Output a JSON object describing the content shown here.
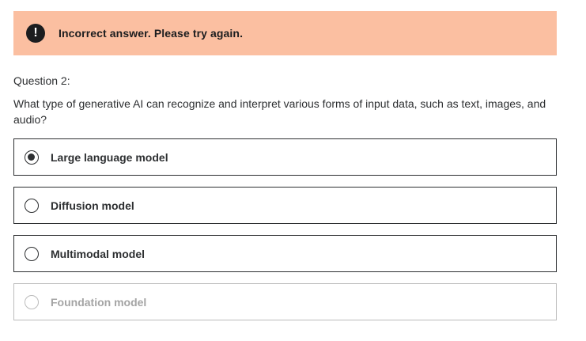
{
  "alert": {
    "icon": "!",
    "icon_name": "exclamation-icon",
    "message": "Incorrect answer. Please try again.",
    "background_color": "#fbbfa1"
  },
  "question": {
    "label": "Question 2:",
    "text": "What type of generative AI can recognize and interpret various forms of input data, such as text, images, and audio?"
  },
  "options": [
    {
      "label": "Large language model",
      "selected": true,
      "disabled": false
    },
    {
      "label": "Diffusion model",
      "selected": false,
      "disabled": false
    },
    {
      "label": "Multimodal model",
      "selected": false,
      "disabled": false
    },
    {
      "label": "Foundation model",
      "selected": false,
      "disabled": true
    }
  ]
}
